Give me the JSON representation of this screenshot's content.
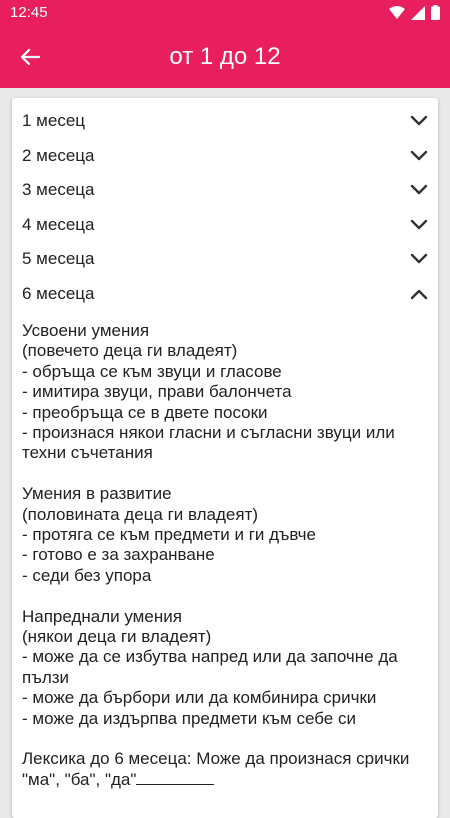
{
  "status": {
    "time": "12:45"
  },
  "appbar": {
    "title": "от 1 до 12",
    "back_icon": "arrow-left-icon"
  },
  "colors": {
    "accent": "#e91e5e"
  },
  "months": [
    {
      "label": "1 месец",
      "expanded": false
    },
    {
      "label": "2 месеца",
      "expanded": false
    },
    {
      "label": "3 месеца",
      "expanded": false
    },
    {
      "label": "4 месеца",
      "expanded": false
    },
    {
      "label": "5 месеца",
      "expanded": false
    },
    {
      "label": "6 месеца",
      "expanded": true
    }
  ],
  "details": {
    "mastered_title": "Усвоени умения",
    "mastered_sub": "(повечето деца ги владеят)",
    "mastered_1": "- обръща се към звуци и гласове",
    "mastered_2": "- имитира звуци, прави балончета",
    "mastered_3": "- преобръща се в двете посоки",
    "mastered_4": "- произнася някои гласни и съгласни звуци или техни съчетания",
    "developing_title": "Умения в развитие",
    "developing_sub": "(половината деца ги владеят)",
    "developing_1": "- протяга се към предмети и ги дъвче",
    "developing_2": "- готово е за захранване",
    "developing_3": "- седи без упора",
    "advanced_title": "Напреднали умения",
    "advanced_sub": "(някои деца ги владеят)",
    "advanced_1": "- може да се избутва напред или да започне да пълзи",
    "advanced_2": "- може да бърбори или да комбинира срички",
    "advanced_3": "- може да издърпва предмети към себе си",
    "lexicon": "Лексика до 6 месеца: Може да произнася срички \"ма\", \"ба\", \"да\""
  }
}
